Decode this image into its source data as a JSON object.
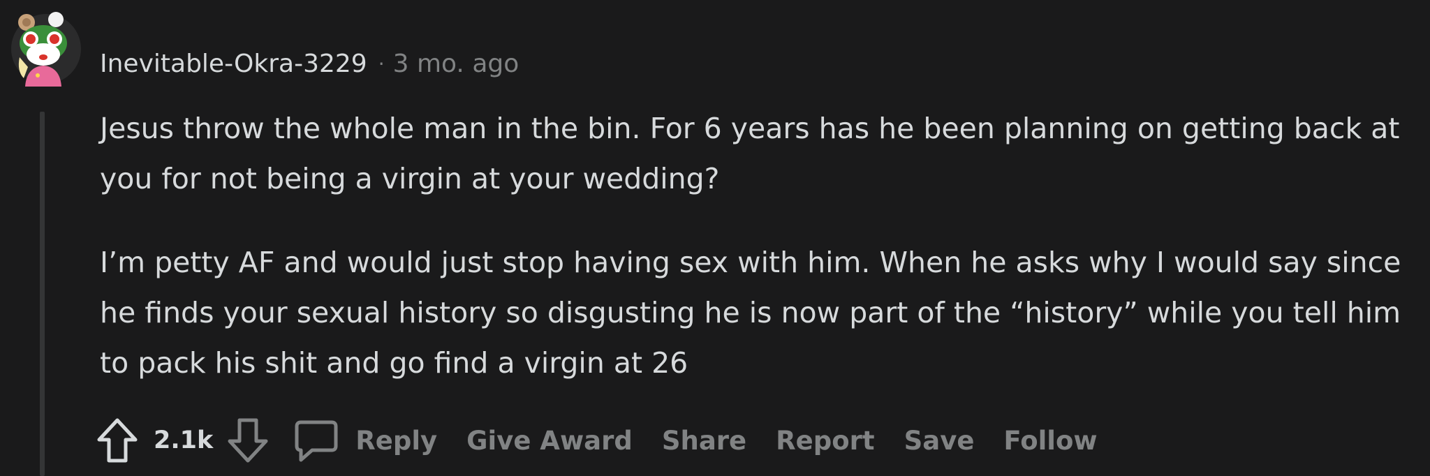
{
  "comment": {
    "author": "Inevitable-Okra-3229",
    "separator": "·",
    "timestamp": "3 mo. ago",
    "paragraphs": [
      "Jesus throw the whole man in the bin. For 6 years has he been planning on getting back at you for not being a virgin at your wedding?",
      "I’m petty AF and would just stop having sex with him. When he asks why I would say since he finds your sexual history so disgusting he is now part of the “history” while you tell him to pack his shit and go find a virgin at 26"
    ],
    "score": "2.1k"
  },
  "actions": {
    "reply": "Reply",
    "give_award": "Give Award",
    "share": "Share",
    "report": "Report",
    "save": "Save",
    "follow": "Follow"
  },
  "icons": {
    "upvote": "upvote-arrow-icon",
    "downvote": "downvote-arrow-icon",
    "reply": "speech-bubble-icon",
    "avatar": "snoo-frog-hat-avatar"
  },
  "colors": {
    "background": "#1a1a1b",
    "text": "#d7dadc",
    "muted": "#818384",
    "thread_line": "#343536"
  }
}
